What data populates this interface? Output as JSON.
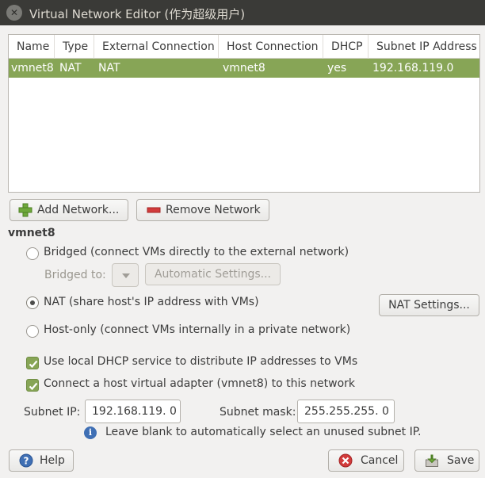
{
  "window": {
    "title": "Virtual Network Editor (作为超级用户)"
  },
  "table": {
    "columns": [
      "Name",
      "Type",
      "External Connection",
      "Host Connection",
      "DHCP",
      "Subnet IP Address"
    ],
    "rows": [
      [
        "vmnet8",
        "NAT",
        "NAT",
        "vmnet8",
        "yes",
        "192.168.119.0"
      ]
    ]
  },
  "buttons": {
    "add_network": "Add Network...",
    "remove_network": "Remove Network",
    "automatic_settings": "Automatic Settings...",
    "nat_settings": "NAT Settings...",
    "help": "Help",
    "cancel": "Cancel",
    "save": "Save"
  },
  "section": {
    "title": "vmnet8"
  },
  "options": {
    "bridged": "Bridged (connect VMs directly to the external network)",
    "bridged_to_label": "Bridged to:",
    "nat": "NAT (share host's IP address with VMs)",
    "host_only": "Host-only (connect VMs internally in a private network)",
    "selected": "nat"
  },
  "checkboxes": {
    "dhcp": {
      "label": "Use local DHCP service to distribute IP addresses to VMs",
      "checked": true
    },
    "adapter": {
      "label": "Connect a host virtual adapter (vmnet8) to this network",
      "checked": true
    }
  },
  "subnet": {
    "ip_label": "Subnet IP:",
    "ip_value": "192.168.119.  0",
    "mask_label": "Subnet mask:",
    "mask_value": "255.255.255.  0",
    "hint": "Leave blank to automatically select an unused subnet IP."
  },
  "colors": {
    "selection": "#87a556",
    "titlebar": "#3a3a37",
    "background": "#f2f1f0"
  },
  "icons": {
    "close": "close-icon",
    "add": "plus-icon",
    "remove": "minus-icon",
    "help": "help-icon",
    "cancel": "cancel-icon",
    "save": "save-icon",
    "info": "info-icon"
  }
}
